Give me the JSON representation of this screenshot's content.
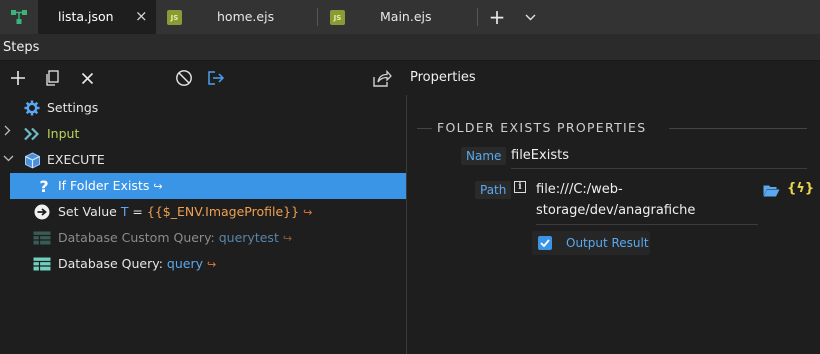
{
  "tabs": [
    {
      "label": "lista.json",
      "active": true,
      "close": "×"
    },
    {
      "label": "home.ejs",
      "badge": "JS"
    },
    {
      "label": "Main.ejs",
      "badge": "JS"
    }
  ],
  "tabbar": {
    "add": "+",
    "more": "⌄"
  },
  "steps_header": {
    "title": "Steps"
  },
  "toolbar": {
    "properties_title": "Properties"
  },
  "tree": {
    "settings": "Settings",
    "input": "Input",
    "execute": "EXECUTE",
    "if_folder": "If Folder Exists",
    "set_value_prefix": "Set Value ",
    "set_value_var": "T",
    "set_value_eq": " = ",
    "set_value_expr": "{{$_ENV.ImageProfile}}",
    "db_custom_label": "Database Custom Query: ",
    "db_custom_name": "querytest",
    "db_query_label": "Database Query: ",
    "db_query_name": "query"
  },
  "properties": {
    "section_title": "FOLDER EXISTS PROPERTIES",
    "name_label": "Name",
    "name_value": "fileExists",
    "path_label": "Path",
    "path_info": "i",
    "path_value_line1": "file:///C:/web-",
    "path_value_line2": "storage/dev/anagrafiche",
    "path_dynamic": "{ϟ}",
    "output_label": "Output Result",
    "output_checked": true
  },
  "colors": {
    "accent": "#3b95e6",
    "link": "#5aa9f0",
    "exit_icon": "#e07b39",
    "ejs_badge": "#8a9a35"
  }
}
